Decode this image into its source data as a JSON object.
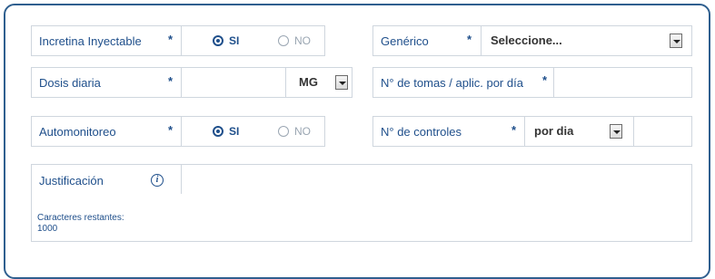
{
  "row1": {
    "incretina": {
      "label": "Incretina Inyectable",
      "required": "*",
      "yes_label": "SI",
      "no_label": "NO",
      "selected": "SI"
    },
    "generico": {
      "label": "Genérico",
      "required": "*",
      "value": "Seleccione..."
    }
  },
  "row2": {
    "dosis": {
      "label": "Dosis diaria",
      "required": "*",
      "value": "",
      "unit": "MG"
    },
    "tomas": {
      "label": "N° de tomas / aplic. por día",
      "required": "*",
      "value": ""
    }
  },
  "row3": {
    "automonitoreo": {
      "label": "Automonitoreo",
      "required": "*",
      "yes_label": "SI",
      "no_label": "NO",
      "selected": "SI"
    },
    "controles": {
      "label": "N° de controles",
      "required": "*",
      "frequency": "por dia",
      "value": ""
    }
  },
  "justificacion": {
    "label": "Justificación",
    "info_icon": "info-icon",
    "value": "",
    "remaining_label": "Caracteres restantes:",
    "remaining_count": "1000"
  },
  "colors": {
    "border": "#2f5f8f",
    "label": "#1f4f8b",
    "field_border": "#cfd6de",
    "disabled": "#9aa6b2"
  }
}
